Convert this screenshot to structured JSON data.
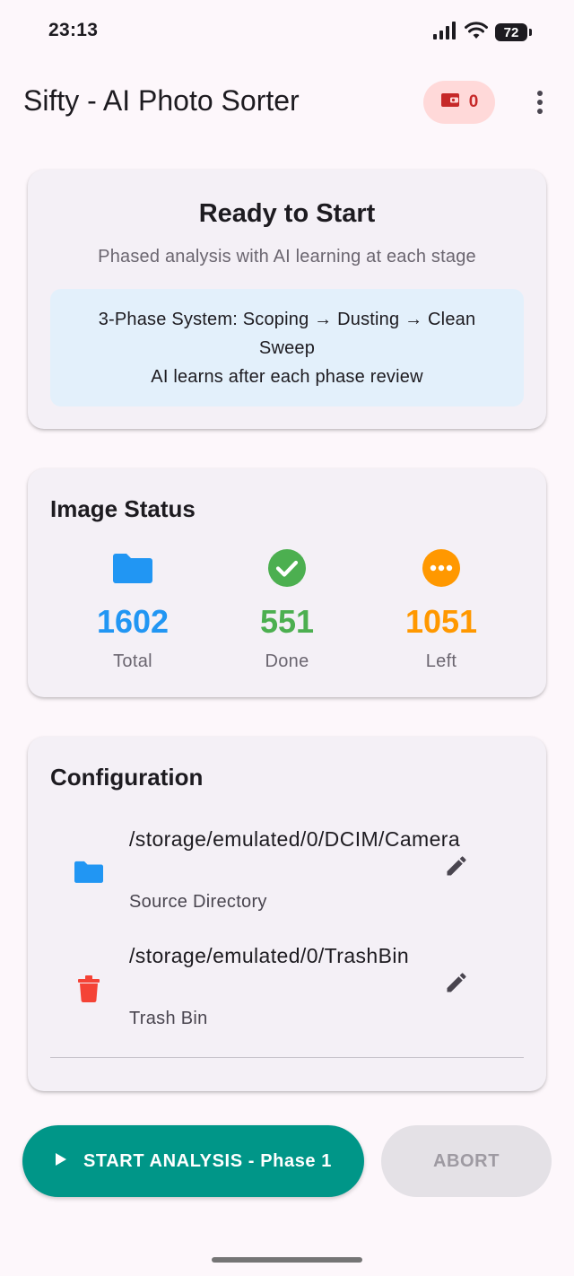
{
  "status_bar": {
    "time": "23:13",
    "battery": "72"
  },
  "app_bar": {
    "title": "Sifty - AI Photo Sorter",
    "credits": "0"
  },
  "ready_card": {
    "title": "Ready to Start",
    "subtitle": "Phased analysis with AI learning at each stage",
    "info_line1": "3-Phase System: Scoping → Dusting → Clean Sweep",
    "info_line2": "AI learns after each phase review"
  },
  "image_status": {
    "title": "Image Status",
    "stats": [
      {
        "value": "1602",
        "label": "Total",
        "color": "#2196f3",
        "icon": "folder-icon"
      },
      {
        "value": "551",
        "label": "Done",
        "color": "#4caf50",
        "icon": "check-circle-icon"
      },
      {
        "value": "1051",
        "label": "Left",
        "color": "#ff9800",
        "icon": "more-circle-icon"
      }
    ]
  },
  "configuration": {
    "title": "Configuration",
    "source": {
      "path": "/storage/emulated/0/DCIM/Camera",
      "label": "Source Directory",
      "icon": "folder-icon",
      "icon_color": "#2196f3"
    },
    "trash": {
      "path": "/storage/emulated/0/TrashBin",
      "label": "Trash Bin",
      "icon": "trash-icon",
      "icon_color": "#f44336"
    }
  },
  "actions": {
    "start_label": "START ANALYSIS - Phase 1",
    "abort_label": "ABORT"
  },
  "colors": {
    "accent": "#009688",
    "credit_chip_bg": "#ffd9d9",
    "credit_chip_fg": "#c62828"
  }
}
